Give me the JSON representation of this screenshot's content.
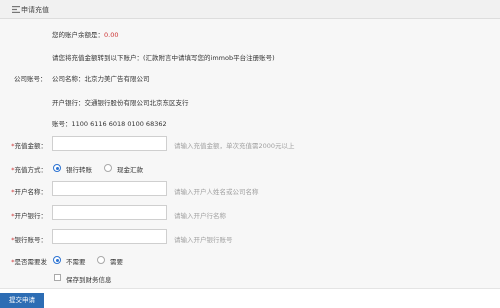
{
  "header": {
    "title": "申请充值",
    "icon": "recharge-list-icon"
  },
  "account_info": {
    "balance_label": "您的账户余额是：",
    "balance_value": "0.00",
    "notice": "请您将充值金额转到以下账户：(汇款附言中请填写您的immob平台注册账号)",
    "company_account_label": "公司账号：",
    "company_name": "公司名称：北京力美广告有限公司",
    "bank": "开户银行：交通银行股份有限公司北京东区支行",
    "account_no": "账号：1100 6116 6018 0100 68362"
  },
  "form": {
    "amount": {
      "label": "充值金额：",
      "value": "",
      "hint": "请输入充值金额，单次充值需2000元以上"
    },
    "method": {
      "label": "充值方式：",
      "options": [
        "银行转账",
        "现金汇款"
      ],
      "selected": "银行转账"
    },
    "account_name": {
      "label": "开户名称：",
      "value": "",
      "hint": "请输入开户人姓名或公司名称"
    },
    "account_bank": {
      "label": "开户银行：",
      "value": "",
      "hint": "请输入开户行名称"
    },
    "account_number": {
      "label": "银行账号：",
      "value": "",
      "hint": "请输入开户银行账号"
    },
    "invoice": {
      "label": "是否需要发",
      "options": [
        "不需要",
        "需要"
      ],
      "selected": "不需要"
    },
    "save_finance": {
      "label": "保存到财务信息",
      "checked": false
    }
  },
  "submit_label": "提交申请",
  "colors": {
    "accent": "#2d6db4",
    "required": "#cc3333",
    "balance": "#cc3333"
  }
}
